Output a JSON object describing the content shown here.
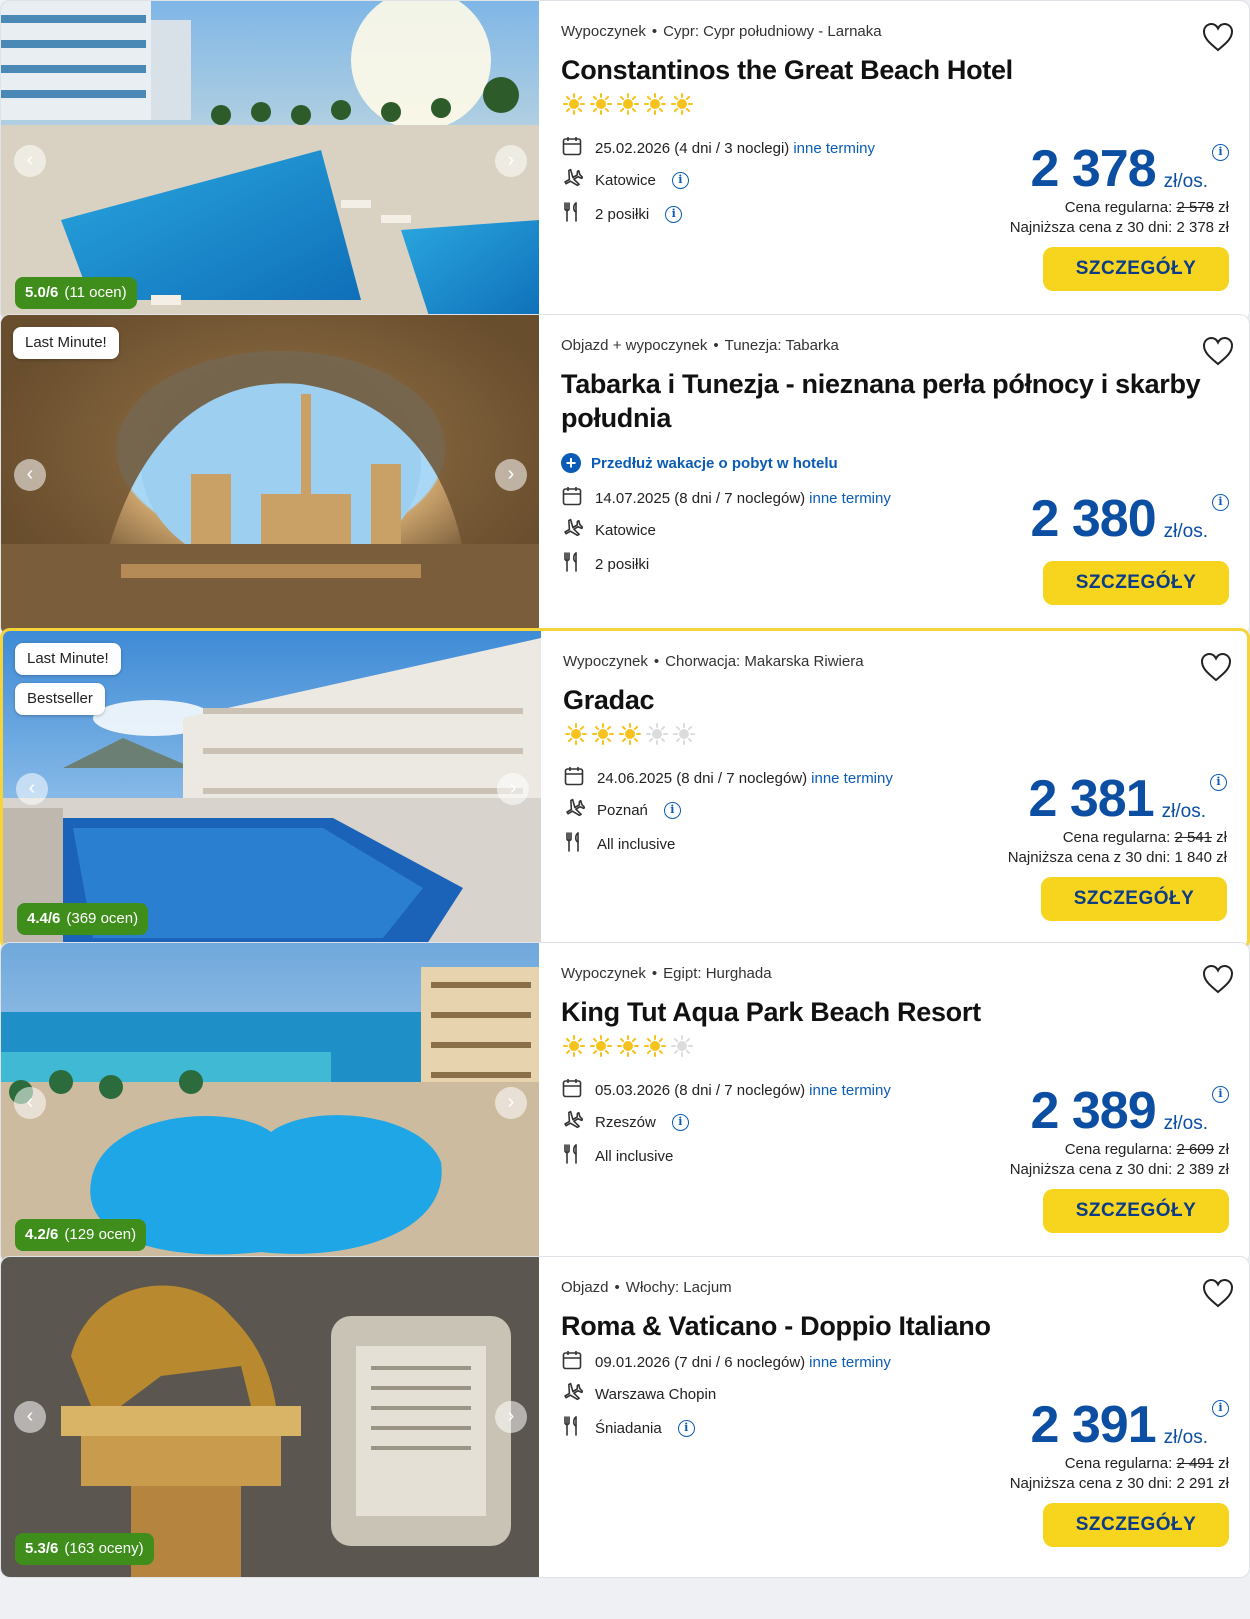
{
  "colors": {
    "accent": "#0b4ea2",
    "button": "#f7d41e",
    "rating": "#3f8e1c",
    "highlight_border": "#f5d33a"
  },
  "offers": [
    {
      "image_icon": "photo-hotel-pool",
      "badges": [],
      "rating": {
        "score": "5.0/6",
        "count": "(11 ocen)"
      },
      "type": "Wypoczynek",
      "location": "Cypr: Cypr południowy - Larnaka",
      "title": "Constantinos the Great Beach Hotel",
      "stars": 5,
      "extend": null,
      "date": "25.02.2026 (4 dni / 3 noclegi)",
      "other_dates": "inne terminy",
      "departure": "Katowice",
      "departure_info": true,
      "meals": "2 posiłki",
      "meals_info": true,
      "price": "2 378",
      "unit": "zł/os.",
      "regular_label": "Cena regularna:",
      "regular_value": "2 578",
      "regular_currency": "zł",
      "lowest": "Najniższa cena z 30 dni: 2 378 zł",
      "button": "SZCZEGÓŁY"
    },
    {
      "image_icon": "photo-cave-ruins",
      "badges": [
        "Last Minute!"
      ],
      "rating": null,
      "type": "Objazd + wypoczynek",
      "location": "Tunezja: Tabarka",
      "title": "Tabarka i Tunezja - nieznana perła północy i skarby południa",
      "stars": 0,
      "extend": "Przedłuż wakacje o pobyt w hotelu",
      "date": "14.07.2025 (8 dni / 7 noclegów)",
      "other_dates": "inne terminy",
      "departure": "Katowice",
      "departure_info": false,
      "meals": "2 posiłki",
      "meals_info": false,
      "price": "2 380",
      "unit": "zł/os.",
      "regular_label": null,
      "regular_value": null,
      "regular_currency": null,
      "lowest": null,
      "button": "SZCZEGÓŁY"
    },
    {
      "image_icon": "photo-hotel-pool",
      "badges": [
        "Last Minute!",
        "Bestseller"
      ],
      "rating": {
        "score": "4.4/6",
        "count": "(369 ocen)"
      },
      "type": "Wypoczynek",
      "location": "Chorwacja: Makarska Riwiera",
      "title": "Gradac",
      "stars": 3,
      "extend": null,
      "date": "24.06.2025 (8 dni / 7 noclegów)",
      "other_dates": "inne terminy",
      "departure": "Poznań",
      "departure_info": true,
      "meals": "All inclusive",
      "meals_info": false,
      "price": "2 381",
      "unit": "zł/os.",
      "regular_label": "Cena regularna:",
      "regular_value": "2 541",
      "regular_currency": "zł",
      "lowest": "Najniższa cena z 30 dni: 1 840 zł",
      "button": "SZCZEGÓŁY"
    },
    {
      "image_icon": "photo-resort-sea",
      "badges": [],
      "rating": {
        "score": "4.2/6",
        "count": "(129 ocen)"
      },
      "type": "Wypoczynek",
      "location": "Egipt: Hurghada",
      "title": "King Tut Aqua Park Beach Resort",
      "stars": 4,
      "extend": null,
      "date": "05.03.2026 (8 dni / 7 noclegów)",
      "other_dates": "inne terminy",
      "departure": "Rzeszów",
      "departure_info": true,
      "meals": "All inclusive",
      "meals_info": false,
      "price": "2 389",
      "unit": "zł/os.",
      "regular_label": "Cena regularna:",
      "regular_value": "2 609",
      "regular_currency": "zł",
      "lowest": "Najniższa cena z 30 dni: 2 389 zł",
      "button": "SZCZEGÓŁY"
    },
    {
      "image_icon": "photo-roman-statue",
      "badges": [],
      "rating": {
        "score": "5.3/6",
        "count": "(163 oceny)"
      },
      "type": "Objazd",
      "location": "Włochy: Lacjum",
      "title": "Roma & Vaticano - Doppio Italiano",
      "stars": 0,
      "extend": null,
      "date": "09.01.2026 (7 dni / 6 noclegów)",
      "other_dates": "inne terminy",
      "departure": "Warszawa Chopin",
      "departure_info": false,
      "meals": "Śniadania",
      "meals_info": true,
      "price": "2 391",
      "unit": "zł/os.",
      "regular_label": "Cena regularna:",
      "regular_value": "2 491",
      "regular_currency": "zł",
      "lowest": "Najniższa cena z 30 dni: 2 291 zł",
      "button": "SZCZEGÓŁY"
    }
  ]
}
